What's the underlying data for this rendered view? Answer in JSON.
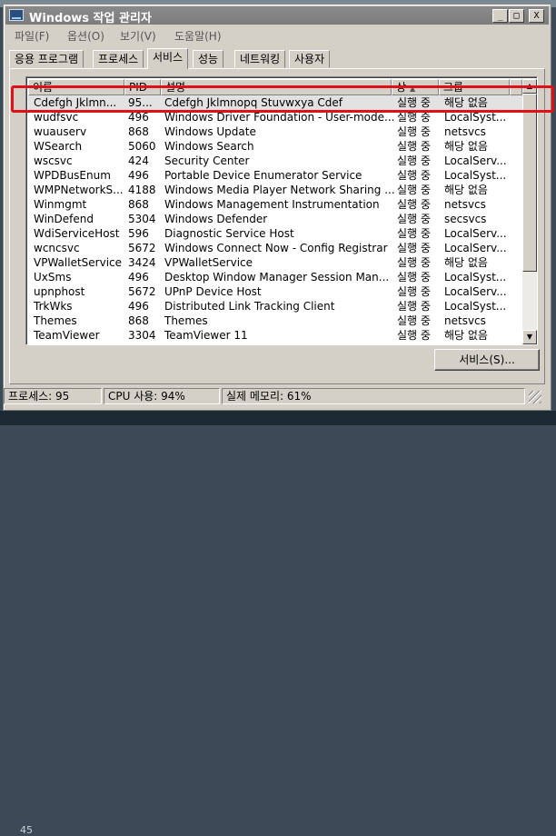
{
  "window": {
    "title": "Windows 작업 관리자"
  },
  "window_controls": {
    "minimize": "_",
    "maximize": "□",
    "close": "X"
  },
  "menu": [
    "파일(F)",
    "옵션(O)",
    "보기(V)",
    "도움말(H)"
  ],
  "tabs": [
    {
      "label": "응용 프로그램"
    },
    {
      "label": "프로세스"
    },
    {
      "label": "서비스",
      "active": true
    },
    {
      "label": "성능"
    },
    {
      "label": "네트워킹"
    },
    {
      "label": "사용자"
    }
  ],
  "table": {
    "columns": [
      "이름",
      "PID",
      "설명",
      "상",
      "그룹"
    ],
    "sort_indicator": "▲",
    "rows": [
      {
        "name": "Cdefgh Jklmn...",
        "pid": "95...",
        "desc": "Cdefgh Jklmnopq Stuvwxya Cdef",
        "status": "실행 중",
        "group": "해당 없음",
        "selected": true
      },
      {
        "name": "wudfsvc",
        "pid": "496",
        "desc": "Windows Driver Foundation - User-mode...",
        "status": "실행 중",
        "group": "LocalSyst..."
      },
      {
        "name": "wuauserv",
        "pid": "868",
        "desc": "Windows Update",
        "status": "실행 중",
        "group": "netsvcs"
      },
      {
        "name": "WSearch",
        "pid": "5060",
        "desc": "Windows Search",
        "status": "실행 중",
        "group": "해당 없음"
      },
      {
        "name": "wscsvc",
        "pid": "424",
        "desc": "Security Center",
        "status": "실행 중",
        "group": "LocalServ..."
      },
      {
        "name": "WPDBusEnum",
        "pid": "496",
        "desc": "Portable Device Enumerator Service",
        "status": "실행 중",
        "group": "LocalSyst..."
      },
      {
        "name": "WMPNetworkS...",
        "pid": "4188",
        "desc": "Windows Media Player Network Sharing ...",
        "status": "실행 중",
        "group": "해당 없음"
      },
      {
        "name": "Winmgmt",
        "pid": "868",
        "desc": "Windows Management Instrumentation",
        "status": "실행 중",
        "group": "netsvcs"
      },
      {
        "name": "WinDefend",
        "pid": "5304",
        "desc": "Windows Defender",
        "status": "실행 중",
        "group": "secsvcs"
      },
      {
        "name": "WdiServiceHost",
        "pid": "596",
        "desc": "Diagnostic Service Host",
        "status": "실행 중",
        "group": "LocalServ..."
      },
      {
        "name": "wcncsvc",
        "pid": "5672",
        "desc": "Windows Connect Now - Config Registrar",
        "status": "실행 중",
        "group": "LocalServ..."
      },
      {
        "name": "VPWalletService",
        "pid": "3424",
        "desc": "VPWalletService",
        "status": "실행 중",
        "group": "해당 없음"
      },
      {
        "name": "UxSms",
        "pid": "496",
        "desc": "Desktop Window Manager Session Man...",
        "status": "실행 중",
        "group": "LocalSyst..."
      },
      {
        "name": "upnphost",
        "pid": "5672",
        "desc": "UPnP Device Host",
        "status": "실행 중",
        "group": "LocalServ..."
      },
      {
        "name": "TrkWks",
        "pid": "496",
        "desc": "Distributed Link Tracking Client",
        "status": "실행 중",
        "group": "LocalSyst..."
      },
      {
        "name": "Themes",
        "pid": "868",
        "desc": "Themes",
        "status": "실행 중",
        "group": "netsvcs"
      },
      {
        "name": "TeamViewer",
        "pid": "3304",
        "desc": "TeamViewer 11",
        "status": "실행 중",
        "group": "해당 없음"
      }
    ]
  },
  "scrollbar": {
    "up": "▲",
    "down": "▼"
  },
  "services_button": "서비스(S)...",
  "status_bar": {
    "processes": "프로세스: 95",
    "cpu": "CPU 사용: 94%",
    "memory": "실제 메모리: 61%"
  },
  "background_number": "45",
  "highlight_color": "#e0101a"
}
